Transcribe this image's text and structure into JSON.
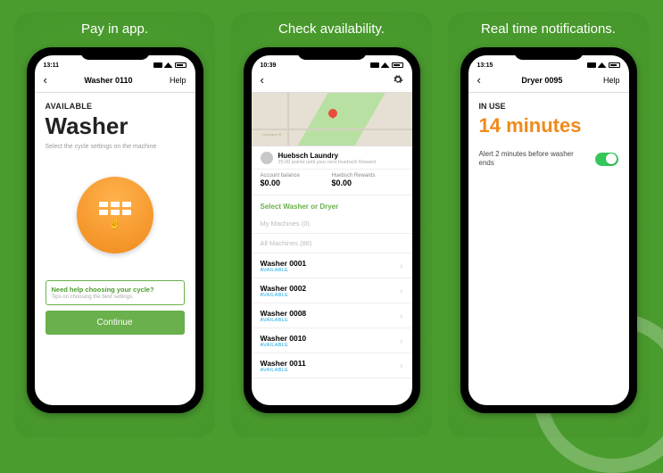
{
  "panels": [
    {
      "caption": "Pay in app."
    },
    {
      "caption": "Check availability."
    },
    {
      "caption": "Real time notifications."
    }
  ],
  "screen1": {
    "time": "13:11",
    "nav_title": "Washer 0110",
    "nav_help": "Help",
    "status": "AVAILABLE",
    "title": "Washer",
    "subtitle": "Select the cycle settings on the machine",
    "help_title": "Need help choosing your cycle?",
    "help_sub": "Tips on choosing the best settings.",
    "continue": "Continue"
  },
  "screen2": {
    "time": "10:39",
    "location_name": "Huebsch Laundry",
    "location_sub": "25.00 points until your next Huebsch Reward",
    "balance_label": "Account balance",
    "balance_value": "$0.00",
    "rewards_label": "Huebsch Rewards",
    "rewards_value": "$0.00",
    "section_header": "Select Washer or Dryer",
    "my_machines": "My Machines (0)",
    "all_machines": "All Machines (88)",
    "machines": [
      {
        "name": "Washer 0001",
        "status": "AVAILABLE"
      },
      {
        "name": "Washer 0002",
        "status": "AVAILABLE"
      },
      {
        "name": "Washer 0008",
        "status": "AVAILABLE"
      },
      {
        "name": "Washer 0010",
        "status": "AVAILABLE"
      },
      {
        "name": "Washer 0011",
        "status": "AVAILABLE"
      }
    ]
  },
  "screen3": {
    "time": "13:15",
    "nav_title": "Dryer 0095",
    "nav_help": "Help",
    "status": "IN USE",
    "time_left": "14 minutes",
    "alert_text": "Alert 2 minutes before washer ends"
  }
}
